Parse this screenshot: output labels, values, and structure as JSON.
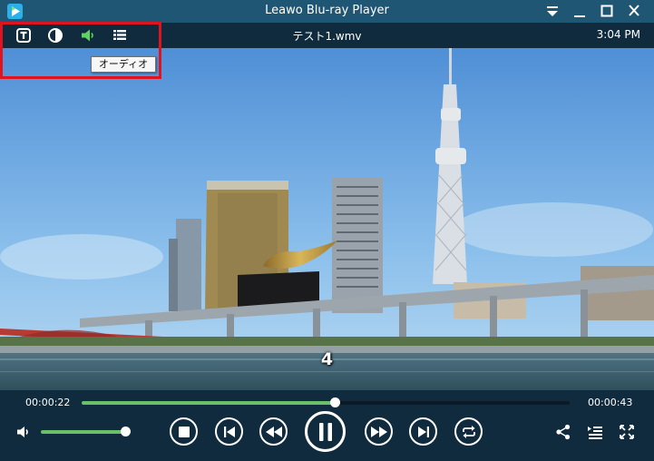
{
  "window": {
    "title": "Leawo Blu-ray Player"
  },
  "topbar": {
    "file_name": "テスト1.wmv",
    "clock": "3:04 PM",
    "tooltip": "オーディオ",
    "audio_icon_color": "#5fd35f",
    "highlight_color": "#e0141e"
  },
  "video": {
    "subtitle_text": "4"
  },
  "playback": {
    "elapsed": "00:00:22",
    "duration": "00:00:43",
    "progress": 0.518,
    "volume": 1.0,
    "accent_color": "#6abf69"
  },
  "icons": {
    "subtitle": "subtitle-icon",
    "brightness": "brightness-icon",
    "audio": "speaker-icon",
    "playlist": "playlist-icon",
    "volume": "volume-icon",
    "stop": "stop-icon",
    "previous": "skip-previous-icon",
    "rewind": "rewind-icon",
    "pause": "pause-icon",
    "forward": "fast-forward-icon",
    "next": "skip-next-icon",
    "repeat": "repeat-icon",
    "share": "share-icon",
    "chapters": "chapter-list-icon",
    "fullscreen": "fullscreen-icon"
  }
}
